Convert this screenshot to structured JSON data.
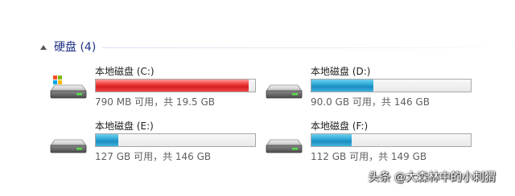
{
  "group": {
    "title": "硬盘 (4)"
  },
  "drives": [
    {
      "label": "本地磁盘 (C:)",
      "free_text": "790 MB 可用，共 19.5 GB",
      "used_fraction": 0.96,
      "bar_color": "#d62b2b"
    },
    {
      "label": "本地磁盘 (D:)",
      "free_text": "90.0 GB 可用，共 146 GB",
      "used_fraction": 0.39,
      "bar_color": "#2aa3d2"
    },
    {
      "label": "本地磁盘 (E:)",
      "free_text": "127 GB 可用，共 146 GB",
      "used_fraction": 0.14,
      "bar_color": "#2aa3d2"
    },
    {
      "label": "本地磁盘 (F:)",
      "free_text": "112 GB 可用，共 149 GB",
      "used_fraction": 0.25,
      "bar_color": "#2aa3d2"
    }
  ],
  "watermark": "头条 @大森林中的小刺猬"
}
